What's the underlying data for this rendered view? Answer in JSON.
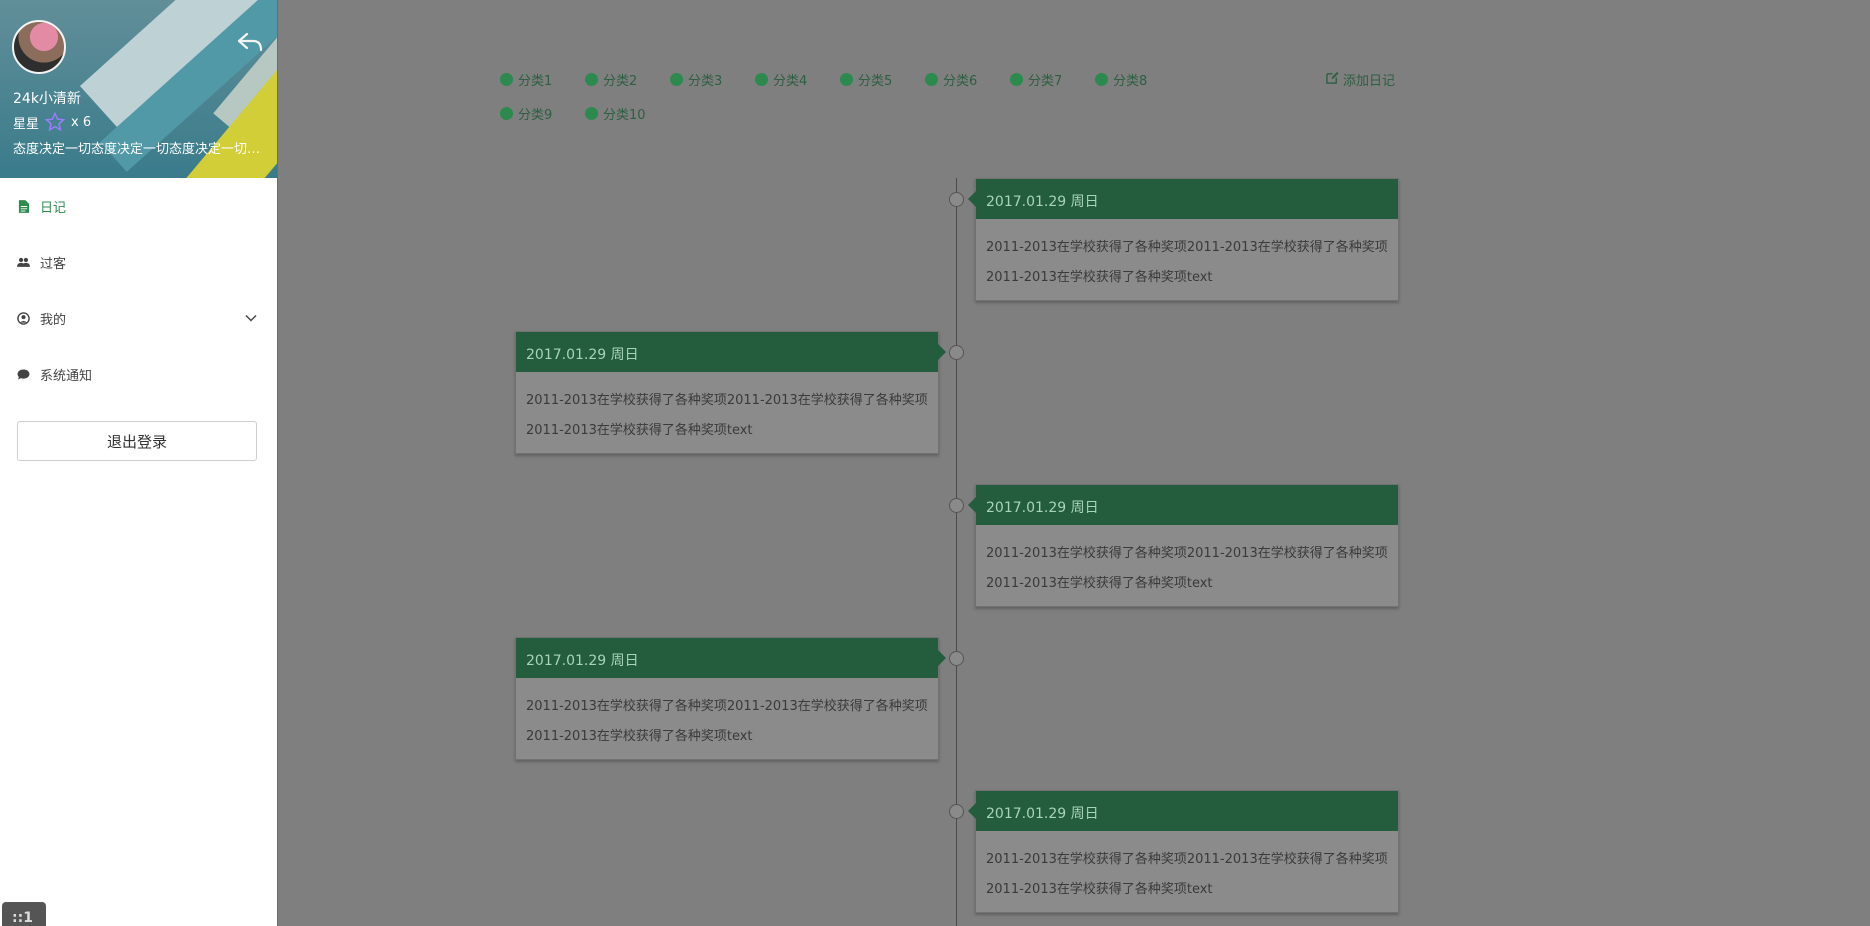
{
  "profile": {
    "name": "24k小清新",
    "stars_label": "星星",
    "stars_count": "x 6",
    "motto": "态度决定一切态度决定一切态度决定一切态度决定一切态度决定一切"
  },
  "nav": {
    "items": [
      {
        "label": "日记",
        "icon": "file-icon",
        "active": true
      },
      {
        "label": "过客",
        "icon": "users-icon",
        "active": false
      },
      {
        "label": "我的",
        "icon": "user-circle-icon",
        "active": false,
        "expandable": true
      },
      {
        "label": "系统通知",
        "icon": "comment-icon",
        "active": false
      }
    ],
    "logout_label": "退出登录"
  },
  "corner_badge": "::1",
  "categories": [
    "分类1",
    "分类2",
    "分类3",
    "分类4",
    "分类5",
    "分类6",
    "分类7",
    "分类8",
    "分类9",
    "分类10"
  ],
  "add_diary_label": "添加日记",
  "entries": [
    {
      "date": "2017.01.29 周日",
      "text": "2011-2013在学校获得了各种奖项2011-2013在学校获得了各种奖项2011-2013在学校获得了各种奖项text",
      "side": "right"
    },
    {
      "date": "2017.01.29 周日",
      "text": "2011-2013在学校获得了各种奖项2011-2013在学校获得了各种奖项2011-2013在学校获得了各种奖项text",
      "side": "left"
    },
    {
      "date": "2017.01.29 周日",
      "text": "2011-2013在学校获得了各种奖项2011-2013在学校获得了各种奖项2011-2013在学校获得了各种奖项text",
      "side": "right"
    },
    {
      "date": "2017.01.29 周日",
      "text": "2011-2013在学校获得了各种奖项2011-2013在学校获得了各种奖项2011-2013在学校获得了各种奖项text",
      "side": "left"
    },
    {
      "date": "2017.01.29 周日",
      "text": "2011-2013在学校获得了各种奖项2011-2013在学校获得了各种奖项2011-2013在学校获得了各种奖项text",
      "side": "right"
    }
  ],
  "colors": {
    "accent": "#2e8c4f",
    "card_header": "#245c3e",
    "overlay": "#7f7f7f"
  }
}
